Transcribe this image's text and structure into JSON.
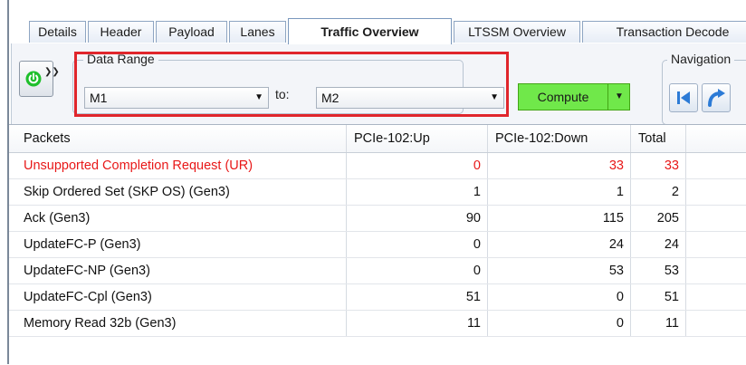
{
  "tabs": [
    {
      "label": "Details",
      "active": false
    },
    {
      "label": "Header",
      "active": false
    },
    {
      "label": "Payload",
      "active": false
    },
    {
      "label": "Lanes",
      "active": false
    },
    {
      "label": "Traffic Overview",
      "active": true
    },
    {
      "label": "LTSSM Overview",
      "active": false
    },
    {
      "label": "Transaction Decode",
      "active": false
    }
  ],
  "toolbar": {
    "power_icon": "power-icon",
    "data_range": {
      "legend": "Data Range",
      "from_value": "M1",
      "to_label": "to:",
      "to_value": "M2",
      "compute_label": "Compute"
    },
    "navigation": {
      "legend": "Navigation",
      "buttons": [
        "skip-to-start-icon",
        "redo-arrow-icon"
      ]
    }
  },
  "grid": {
    "columns": [
      "Packets",
      "PCIe-102:Up",
      "PCIe-102:Down",
      "Total"
    ],
    "rows": [
      {
        "packet": "Unsupported Completion Request (UR)",
        "up": "0",
        "down": "33",
        "total": "33",
        "alert": true
      },
      {
        "packet": "Skip Ordered Set (SKP OS) (Gen3)",
        "up": "1",
        "down": "1",
        "total": "2",
        "alert": false
      },
      {
        "packet": "Ack (Gen3)",
        "up": "90",
        "down": "115",
        "total": "205",
        "alert": false
      },
      {
        "packet": "UpdateFC-P (Gen3)",
        "up": "0",
        "down": "24",
        "total": "24",
        "alert": false
      },
      {
        "packet": "UpdateFC-NP (Gen3)",
        "up": "0",
        "down": "53",
        "total": "53",
        "alert": false
      },
      {
        "packet": "UpdateFC-Cpl (Gen3)",
        "up": "51",
        "down": "0",
        "total": "51",
        "alert": false
      },
      {
        "packet": "Memory Read 32b (Gen3)",
        "up": "11",
        "down": "0",
        "total": "11",
        "alert": false
      }
    ]
  },
  "colors": {
    "alert_text": "#e81818",
    "highlight_border": "#e0262c",
    "compute_green": "#70e84a"
  }
}
